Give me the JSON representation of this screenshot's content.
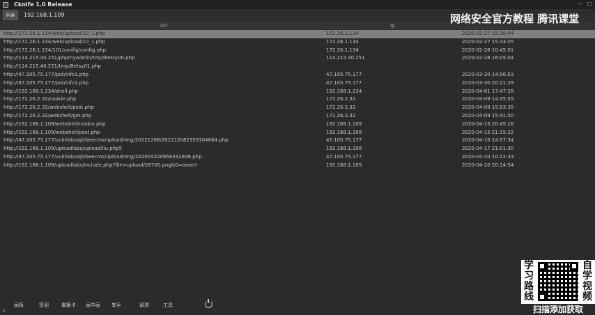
{
  "window": {
    "title": "Cknife 1.0 Release",
    "controls": [
      "—",
      "□"
    ]
  },
  "toolbar": {
    "tab_label": "列表",
    "address": "192.168.1.109"
  },
  "columns": {
    "url": "Url",
    "ip": "Ip"
  },
  "rows": [
    {
      "url": "http://172.26.1.134/web/upload/10_1.php",
      "ip": "172.26.1.134",
      "time": "2020-02-27 15:30:44"
    },
    {
      "url": "http://172.26.1.134/web/upload/10_1.php",
      "ip": "172.26.1.134",
      "time": "2020-02-27 15:33:05"
    },
    {
      "url": "http://172.26.1.134/101/config/config.php",
      "ip": "172.26.1.134",
      "time": "2020-02-28 10:45:01"
    },
    {
      "url": "http://114.215.40.251/phpmyadmin/tmp/Betsy00.php",
      "ip": "114.215.40.251",
      "time": "2020-02-28 16:05:04"
    },
    {
      "url": "http://114.215.40.251/tmp/Betsy01.php",
      "ip": "",
      "time": ""
    },
    {
      "url": "http://47.105.75.177/put/info1.php",
      "ip": "47.105.75.177",
      "time": "2020-03-30 14:06:53"
    },
    {
      "url": "http://47.105.75.177/put/info1.php",
      "ip": "47.105.75.177",
      "time": "2020-03-30 20:21:29"
    },
    {
      "url": "http://192.168.1.234/shell.php",
      "ip": "192.168.1.234",
      "time": "2020-04-01 17:47:28"
    },
    {
      "url": "http://172.26.2.32/cookie.php",
      "ip": "172.26.2.32",
      "time": "2020-04-09 14:35:55"
    },
    {
      "url": "http://172.26.2.32/webshell/post.php",
      "ip": "172.26.2.32",
      "time": "2020-04-09 15:03:35"
    },
    {
      "url": "http://172.26.2.32/webshell/get.php",
      "ip": "172.26.2.32",
      "time": "2020-04-09 15:41:50"
    },
    {
      "url": "http://192.168.1.109/webshell/cookie.php",
      "ip": "192.168.1.109",
      "time": "2020-04-15 20:45:16"
    },
    {
      "url": "http://192.168.1.109/webshell/post.php",
      "ip": "192.168.1.109",
      "time": "2020-04-15 21:15:22"
    },
    {
      "url": "http://47.105.75.177/vulnlab/sqli/beecms/upload/img/20121208/201212082353104864.php",
      "ip": "47.105.75.177",
      "time": "2020-04-16 14:57:34"
    },
    {
      "url": "http://192.168.1.109/uploadlabs/upload/liu.php5",
      "ip": "192.168.1.109",
      "time": "2020-04-17 21:01:30"
    },
    {
      "url": "http://47.105.75.177/vulnlab/sqli/beecms/upload/img/202004200956332948.php",
      "ip": "47.105.75.177",
      "time": "2020-04-20 10:12:33"
    },
    {
      "url": "http://192.168.1.109/uploadlabs/include.php?file=upload/26700.png&0=assert",
      "ip": "192.168.1.109",
      "time": "2020-04-20 20:14:54"
    }
  ],
  "watermark": {
    "line1": "网络安全官方教程 腾讯课堂",
    "line2": ""
  },
  "promo": {
    "left": "学习路线",
    "right": "自学视频",
    "footer": "扫描添加获取"
  },
  "bottom_menu": [
    "画板",
    "签到",
    "書籤卡",
    "画中画",
    "笔手",
    "窗选",
    "工具"
  ],
  "corner_label": "3"
}
